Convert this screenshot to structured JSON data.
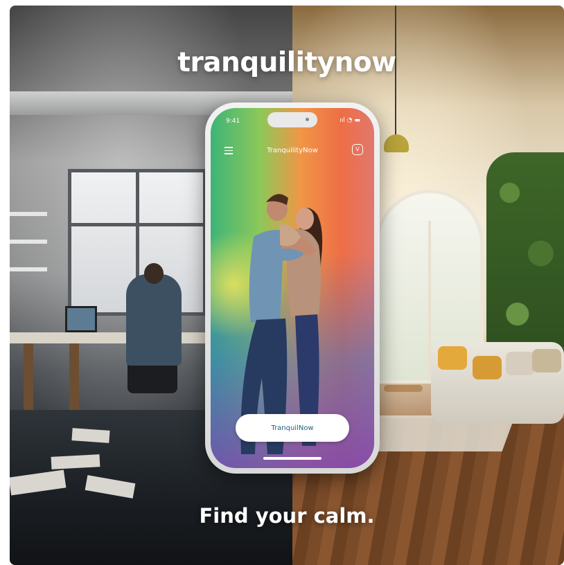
{
  "poster": {
    "brand": "tranquilitynow",
    "tagline": "Find your calm."
  },
  "phone": {
    "status_time": "9:41",
    "status_icons": "ııl ◔ ▬",
    "app_title": "TranquilityNow",
    "profile_icon": "V",
    "cta_label": "TranquilNow"
  },
  "colors": {
    "accent_green": "#3db478",
    "accent_orange": "#ee6e46",
    "accent_purple": "#7846b4",
    "cta_text": "#1f5e7e"
  },
  "icons": [
    "menu-icon",
    "profile-icon",
    "signal-icon",
    "wifi-icon",
    "battery-icon"
  ]
}
